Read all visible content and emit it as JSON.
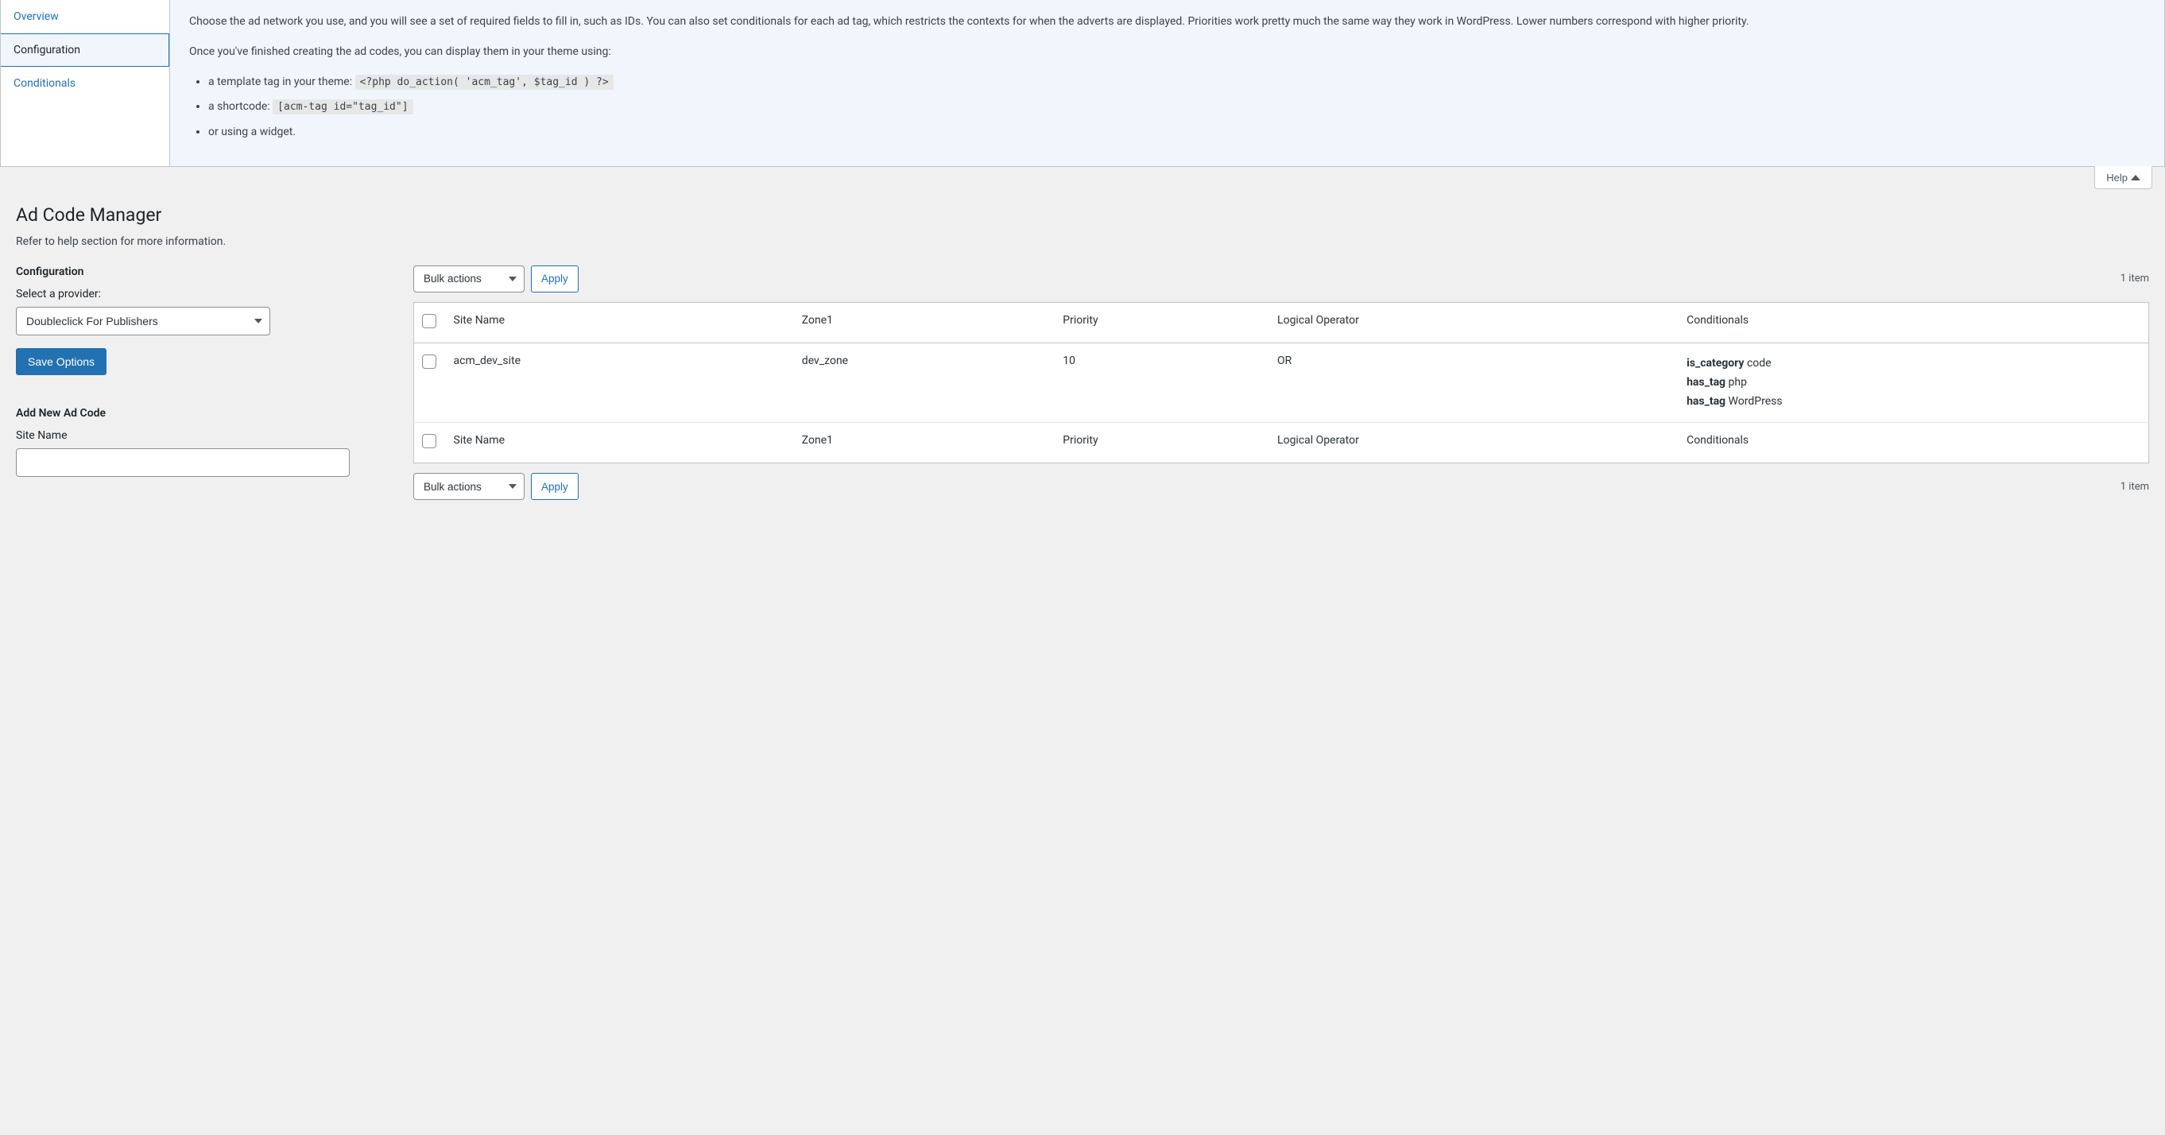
{
  "help": {
    "tabs": [
      "Overview",
      "Configuration",
      "Conditionals"
    ],
    "intro": "Choose the ad network you use, and you will see a set of required fields to fill in, such as IDs. You can also set conditionals for each ad tag, which restricts the contexts for when the adverts are displayed. Priorities work pretty much the same way they work in WordPress. Lower numbers correspond with higher priority.",
    "outro": "Once you've finished creating the ad codes, you can display them in your theme using:",
    "bullets": {
      "templatePrefix": "a template tag in your theme: ",
      "templateCode": "<?php do_action( 'acm_tag', $tag_id ) ?>",
      "shortcodePrefix": "a shortcode: ",
      "shortcodeCode": "[acm-tag id=\"tag_id\"]",
      "widget": "or using a widget."
    },
    "toggleLabel": "Help"
  },
  "page": {
    "title": "Ad Code Manager",
    "subtitle": "Refer to help section for more information."
  },
  "config": {
    "heading": "Configuration",
    "providerLabel": "Select a provider:",
    "providerValue": "Doubleclick For Publishers",
    "saveLabel": "Save Options"
  },
  "addNew": {
    "heading": "Add New Ad Code",
    "siteNameLabel": "Site Name",
    "siteNameValue": ""
  },
  "list": {
    "bulkActionsLabel": "Bulk actions",
    "applyLabel": "Apply",
    "itemCount": "1 item",
    "columns": [
      "Site Name",
      "Zone1",
      "Priority",
      "Logical Operator",
      "Conditionals"
    ],
    "rows": [
      {
        "siteName": "acm_dev_site",
        "zone": "dev_zone",
        "priority": "10",
        "operator": "OR",
        "conditionals": [
          {
            "func": "is_category",
            "arg": "code"
          },
          {
            "func": "has_tag",
            "arg": "php"
          },
          {
            "func": "has_tag",
            "arg": "WordPress"
          }
        ]
      }
    ]
  }
}
